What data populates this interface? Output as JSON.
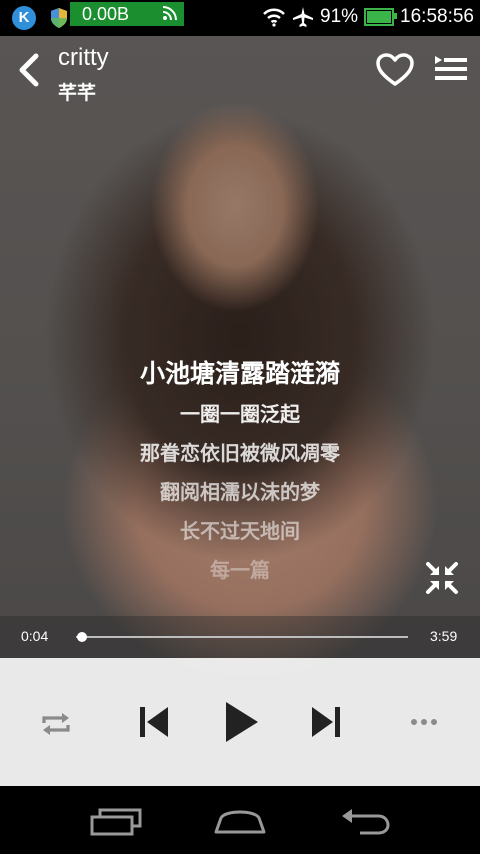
{
  "status_bar": {
    "traffic": "0.00B",
    "battery": "91%",
    "time": "16:58:56",
    "k_badge": "K",
    "traffic_color": "#1b8f2f"
  },
  "header": {
    "title": "critty",
    "artist": "芊芊"
  },
  "lyrics": {
    "current": "小池塘清露踏涟漪",
    "lines": [
      "一圈一圈泛起",
      "那眷恋依旧被微风凋零",
      "翻阅相濡以沫的梦",
      "长不过天地间",
      "每一篇"
    ]
  },
  "player": {
    "elapsed": "0:04",
    "duration": "3:59",
    "progress": 0.017
  },
  "icons": {
    "back": "chevron-left-icon",
    "favorite": "heart-outline-icon",
    "playlist": "playlist-icon",
    "collapse": "collapse-arrows-icon",
    "repeat": "repeat-icon",
    "previous": "skip-previous-icon",
    "play": "play-icon",
    "next": "skip-next-icon",
    "more": "more-horizontal-icon",
    "recent": "recent-apps-icon",
    "home": "home-icon",
    "nav_back": "nav-back-icon"
  }
}
